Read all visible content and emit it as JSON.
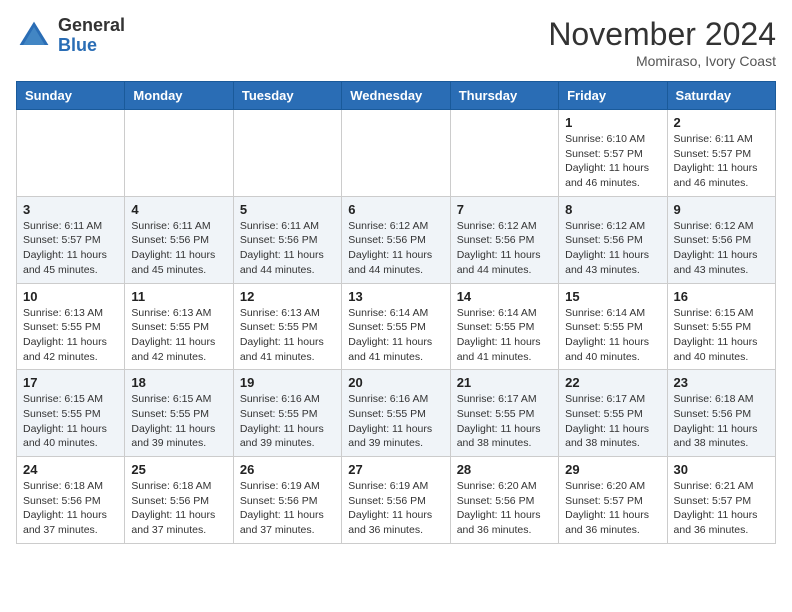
{
  "logo": {
    "text_general": "General",
    "text_blue": "Blue"
  },
  "title": "November 2024",
  "location": "Momiraso, Ivory Coast",
  "days_of_week": [
    "Sunday",
    "Monday",
    "Tuesday",
    "Wednesday",
    "Thursday",
    "Friday",
    "Saturday"
  ],
  "weeks": [
    [
      {
        "day": "",
        "info": ""
      },
      {
        "day": "",
        "info": ""
      },
      {
        "day": "",
        "info": ""
      },
      {
        "day": "",
        "info": ""
      },
      {
        "day": "",
        "info": ""
      },
      {
        "day": "1",
        "info": "Sunrise: 6:10 AM\nSunset: 5:57 PM\nDaylight: 11 hours\nand 46 minutes."
      },
      {
        "day": "2",
        "info": "Sunrise: 6:11 AM\nSunset: 5:57 PM\nDaylight: 11 hours\nand 46 minutes."
      }
    ],
    [
      {
        "day": "3",
        "info": "Sunrise: 6:11 AM\nSunset: 5:57 PM\nDaylight: 11 hours\nand 45 minutes."
      },
      {
        "day": "4",
        "info": "Sunrise: 6:11 AM\nSunset: 5:56 PM\nDaylight: 11 hours\nand 45 minutes."
      },
      {
        "day": "5",
        "info": "Sunrise: 6:11 AM\nSunset: 5:56 PM\nDaylight: 11 hours\nand 44 minutes."
      },
      {
        "day": "6",
        "info": "Sunrise: 6:12 AM\nSunset: 5:56 PM\nDaylight: 11 hours\nand 44 minutes."
      },
      {
        "day": "7",
        "info": "Sunrise: 6:12 AM\nSunset: 5:56 PM\nDaylight: 11 hours\nand 44 minutes."
      },
      {
        "day": "8",
        "info": "Sunrise: 6:12 AM\nSunset: 5:56 PM\nDaylight: 11 hours\nand 43 minutes."
      },
      {
        "day": "9",
        "info": "Sunrise: 6:12 AM\nSunset: 5:56 PM\nDaylight: 11 hours\nand 43 minutes."
      }
    ],
    [
      {
        "day": "10",
        "info": "Sunrise: 6:13 AM\nSunset: 5:55 PM\nDaylight: 11 hours\nand 42 minutes."
      },
      {
        "day": "11",
        "info": "Sunrise: 6:13 AM\nSunset: 5:55 PM\nDaylight: 11 hours\nand 42 minutes."
      },
      {
        "day": "12",
        "info": "Sunrise: 6:13 AM\nSunset: 5:55 PM\nDaylight: 11 hours\nand 41 minutes."
      },
      {
        "day": "13",
        "info": "Sunrise: 6:14 AM\nSunset: 5:55 PM\nDaylight: 11 hours\nand 41 minutes."
      },
      {
        "day": "14",
        "info": "Sunrise: 6:14 AM\nSunset: 5:55 PM\nDaylight: 11 hours\nand 41 minutes."
      },
      {
        "day": "15",
        "info": "Sunrise: 6:14 AM\nSunset: 5:55 PM\nDaylight: 11 hours\nand 40 minutes."
      },
      {
        "day": "16",
        "info": "Sunrise: 6:15 AM\nSunset: 5:55 PM\nDaylight: 11 hours\nand 40 minutes."
      }
    ],
    [
      {
        "day": "17",
        "info": "Sunrise: 6:15 AM\nSunset: 5:55 PM\nDaylight: 11 hours\nand 40 minutes."
      },
      {
        "day": "18",
        "info": "Sunrise: 6:15 AM\nSunset: 5:55 PM\nDaylight: 11 hours\nand 39 minutes."
      },
      {
        "day": "19",
        "info": "Sunrise: 6:16 AM\nSunset: 5:55 PM\nDaylight: 11 hours\nand 39 minutes."
      },
      {
        "day": "20",
        "info": "Sunrise: 6:16 AM\nSunset: 5:55 PM\nDaylight: 11 hours\nand 39 minutes."
      },
      {
        "day": "21",
        "info": "Sunrise: 6:17 AM\nSunset: 5:55 PM\nDaylight: 11 hours\nand 38 minutes."
      },
      {
        "day": "22",
        "info": "Sunrise: 6:17 AM\nSunset: 5:55 PM\nDaylight: 11 hours\nand 38 minutes."
      },
      {
        "day": "23",
        "info": "Sunrise: 6:18 AM\nSunset: 5:56 PM\nDaylight: 11 hours\nand 38 minutes."
      }
    ],
    [
      {
        "day": "24",
        "info": "Sunrise: 6:18 AM\nSunset: 5:56 PM\nDaylight: 11 hours\nand 37 minutes."
      },
      {
        "day": "25",
        "info": "Sunrise: 6:18 AM\nSunset: 5:56 PM\nDaylight: 11 hours\nand 37 minutes."
      },
      {
        "day": "26",
        "info": "Sunrise: 6:19 AM\nSunset: 5:56 PM\nDaylight: 11 hours\nand 37 minutes."
      },
      {
        "day": "27",
        "info": "Sunrise: 6:19 AM\nSunset: 5:56 PM\nDaylight: 11 hours\nand 36 minutes."
      },
      {
        "day": "28",
        "info": "Sunrise: 6:20 AM\nSunset: 5:56 PM\nDaylight: 11 hours\nand 36 minutes."
      },
      {
        "day": "29",
        "info": "Sunrise: 6:20 AM\nSunset: 5:57 PM\nDaylight: 11 hours\nand 36 minutes."
      },
      {
        "day": "30",
        "info": "Sunrise: 6:21 AM\nSunset: 5:57 PM\nDaylight: 11 hours\nand 36 minutes."
      }
    ]
  ]
}
